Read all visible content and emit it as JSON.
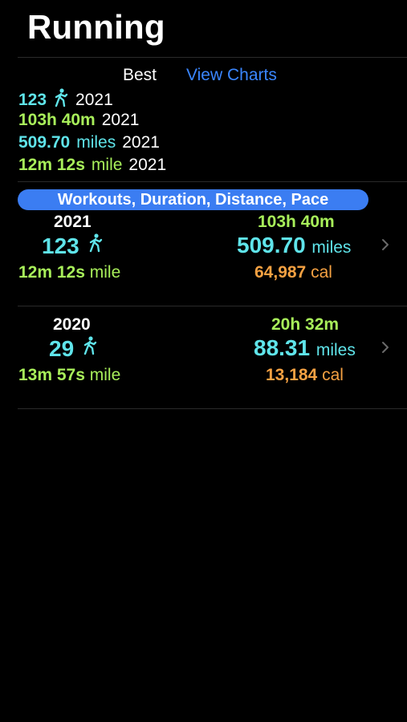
{
  "header": {
    "title": "Running"
  },
  "best": {
    "label": "Best",
    "view_charts": "View Charts",
    "workouts": "123",
    "workouts_year": "2021",
    "duration": "103h 40m",
    "duration_year": "2021",
    "distance": "509.70",
    "distance_unit": "miles",
    "distance_year": "2021",
    "pace": "12m 12s",
    "pace_unit": "mile",
    "pace_year": "2021"
  },
  "pill": {
    "label": "Workouts, Duration, Distance, Pace"
  },
  "years": [
    {
      "year": "2021",
      "workouts": "123",
      "duration": "103h 40m",
      "distance": "509.70",
      "distance_unit": "miles",
      "pace": "12m 12s",
      "pace_unit": "mile",
      "calories": "64,987",
      "calories_unit": "cal"
    },
    {
      "year": "2020",
      "workouts": "29",
      "duration": "20h 32m",
      "distance": "88.31",
      "distance_unit": "miles",
      "pace": "13m 57s",
      "pace_unit": "mile",
      "calories": "13,184",
      "calories_unit": "cal"
    }
  ],
  "colors": {
    "cyan": "#5fe4ea",
    "green": "#a8ef5a",
    "orange": "#f5a142",
    "accent": "#3a86ff",
    "pill": "#3b7df2"
  },
  "icons": {
    "walker": "figure-run-icon",
    "chevron": "chevron-right-icon"
  }
}
